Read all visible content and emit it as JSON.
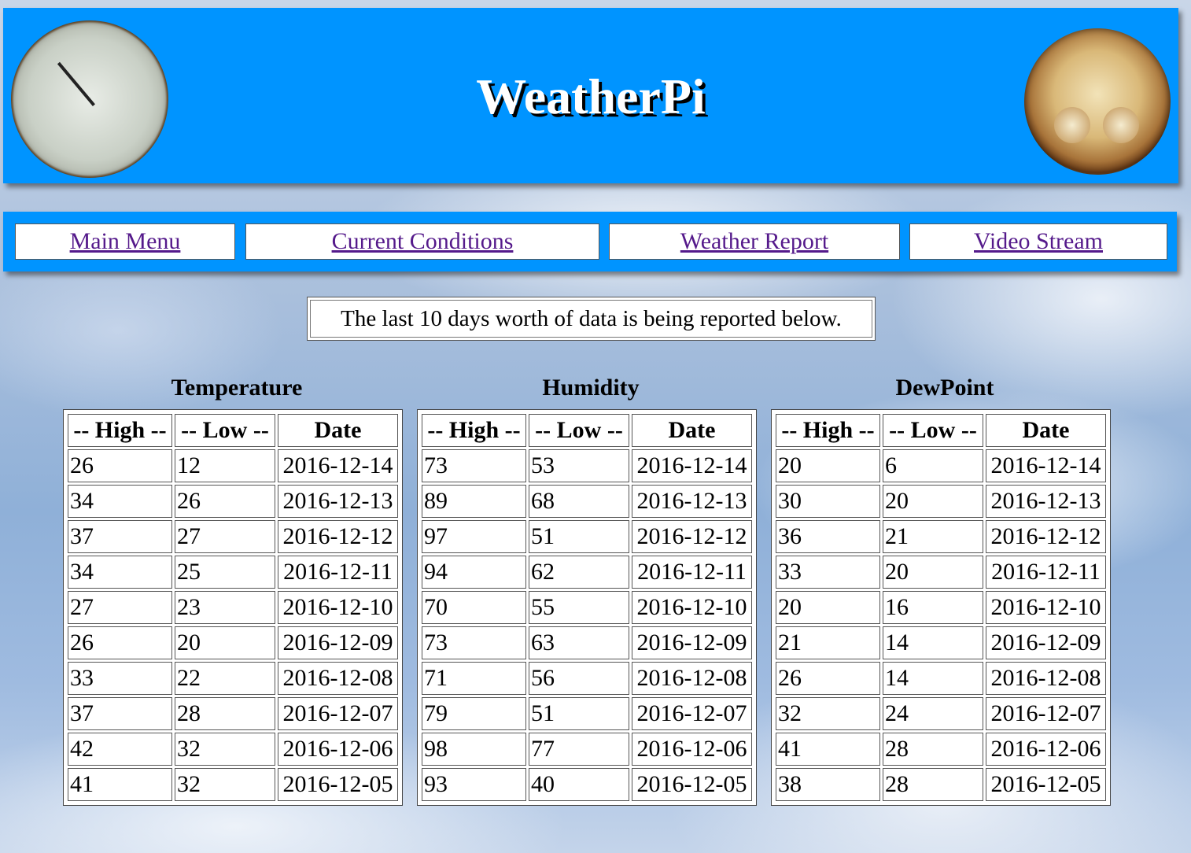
{
  "header": {
    "title": "WeatherPi",
    "left_logo": "thermometer-gauge-icon",
    "right_logo": "barometer-gauge-icon",
    "background_color": "#0094ff"
  },
  "nav": {
    "items": [
      {
        "label": "Main Menu"
      },
      {
        "label": "Current Conditions"
      },
      {
        "label": "Weather Report"
      },
      {
        "label": "Video Stream"
      }
    ],
    "link_color": "#551a8b"
  },
  "notice": "The last 10 days worth of data is being reported below.",
  "tables": [
    {
      "caption": "Temperature",
      "headers": [
        "-- High --",
        "-- Low --",
        "Date"
      ],
      "rows": [
        [
          "26",
          "12",
          "2016-12-14"
        ],
        [
          "34",
          "26",
          "2016-12-13"
        ],
        [
          "37",
          "27",
          "2016-12-12"
        ],
        [
          "34",
          "25",
          "2016-12-11"
        ],
        [
          "27",
          "23",
          "2016-12-10"
        ],
        [
          "26",
          "20",
          "2016-12-09"
        ],
        [
          "33",
          "22",
          "2016-12-08"
        ],
        [
          "37",
          "28",
          "2016-12-07"
        ],
        [
          "42",
          "32",
          "2016-12-06"
        ],
        [
          "41",
          "32",
          "2016-12-05"
        ]
      ]
    },
    {
      "caption": "Humidity",
      "headers": [
        "-- High --",
        "-- Low --",
        "Date"
      ],
      "rows": [
        [
          "73",
          "53",
          "2016-12-14"
        ],
        [
          "89",
          "68",
          "2016-12-13"
        ],
        [
          "97",
          "51",
          "2016-12-12"
        ],
        [
          "94",
          "62",
          "2016-12-11"
        ],
        [
          "70",
          "55",
          "2016-12-10"
        ],
        [
          "73",
          "63",
          "2016-12-09"
        ],
        [
          "71",
          "56",
          "2016-12-08"
        ],
        [
          "79",
          "51",
          "2016-12-07"
        ],
        [
          "98",
          "77",
          "2016-12-06"
        ],
        [
          "93",
          "40",
          "2016-12-05"
        ]
      ]
    },
    {
      "caption": "DewPoint",
      "headers": [
        "-- High --",
        "-- Low --",
        "Date"
      ],
      "rows": [
        [
          "20",
          "6",
          "2016-12-14"
        ],
        [
          "30",
          "20",
          "2016-12-13"
        ],
        [
          "36",
          "21",
          "2016-12-12"
        ],
        [
          "33",
          "20",
          "2016-12-11"
        ],
        [
          "20",
          "16",
          "2016-12-10"
        ],
        [
          "21",
          "14",
          "2016-12-09"
        ],
        [
          "26",
          "14",
          "2016-12-08"
        ],
        [
          "32",
          "24",
          "2016-12-07"
        ],
        [
          "41",
          "28",
          "2016-12-06"
        ],
        [
          "38",
          "28",
          "2016-12-05"
        ]
      ]
    }
  ]
}
